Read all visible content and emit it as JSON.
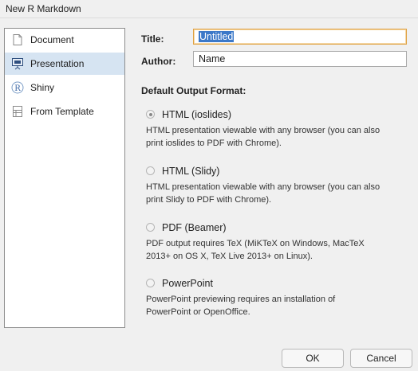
{
  "window": {
    "title": "New R Markdown"
  },
  "sidebar": {
    "items": [
      {
        "label": "Document",
        "icon": "document-icon",
        "selected": false
      },
      {
        "label": "Presentation",
        "icon": "presentation-icon",
        "selected": true
      },
      {
        "label": "Shiny",
        "icon": "shiny-icon",
        "selected": false
      },
      {
        "label": "From Template",
        "icon": "template-icon",
        "selected": false
      }
    ]
  },
  "form": {
    "title_label": "Title:",
    "title_value": "Untitled",
    "author_label": "Author:",
    "author_value": "Name"
  },
  "output": {
    "heading": "Default Output Format:",
    "selected": "HTML (ioslides)",
    "options": [
      {
        "label": "HTML (ioslides)",
        "desc1": "HTML presentation viewable with any browser (you can also",
        "desc2": "print ioslides to PDF with Chrome)."
      },
      {
        "label": "HTML (Slidy)",
        "desc1": "HTML presentation viewable with any browser (you can also",
        "desc2": "print Slidy to PDF with Chrome)."
      },
      {
        "label": "PDF (Beamer)",
        "desc1": "PDF output requires TeX (MiKTeX on Windows, MacTeX",
        "desc2": "2013+ on OS X, TeX Live 2013+ on Linux)."
      },
      {
        "label": "PowerPoint",
        "desc1": "PowerPoint previewing requires an installation of",
        "desc2": "PowerPoint or OpenOffice."
      }
    ]
  },
  "buttons": {
    "ok": "OK",
    "cancel": "Cancel"
  },
  "colors": {
    "selection": "#d6e4f2",
    "focus_border": "#e0a040",
    "text_highlight": "#3b78c8"
  }
}
